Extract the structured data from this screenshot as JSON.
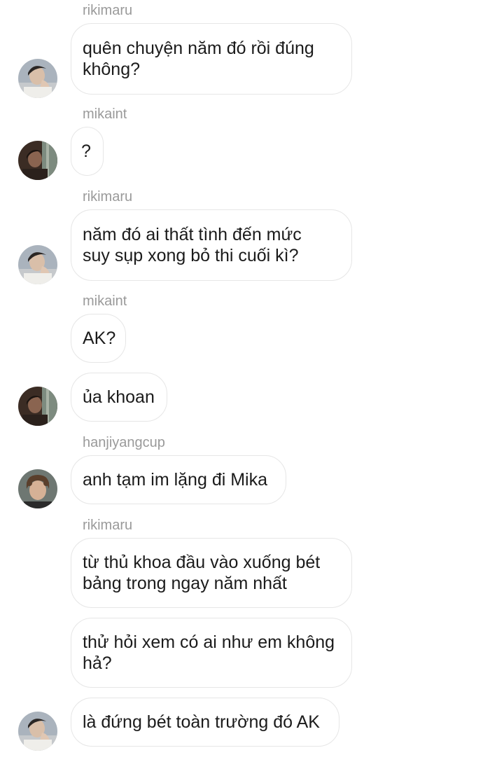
{
  "messages": [
    {
      "sender": "rikimaru",
      "text": "quên chuyện năm đó rồi đúng\nkhông?"
    },
    {
      "sender": "mikaint",
      "text": "?"
    },
    {
      "sender": "rikimaru",
      "text": "năm đó ai thất tình đến mức\nsuy sụp xong bỏ thi cuối kì?"
    },
    {
      "sender": "mikaint",
      "text": "AK?"
    },
    {
      "text": "ủa khoan"
    },
    {
      "sender": "hanjiyangcup",
      "text": "anh tạm im lặng đi Mika"
    },
    {
      "sender": "rikimaru",
      "text": "từ thủ khoa đầu vào xuống bét\nbảng trong ngay năm nhất"
    },
    {
      "text": "thử hỏi xem có ai như em không\nhả?"
    },
    {
      "text": "là đứng bét toàn trường đó AK"
    }
  ],
  "avatars": {
    "rikimaru": "rikimaru-avatar",
    "mikaint": "mikaint-avatar",
    "hanjiyangcup": "hanjiyangcup-avatar"
  }
}
